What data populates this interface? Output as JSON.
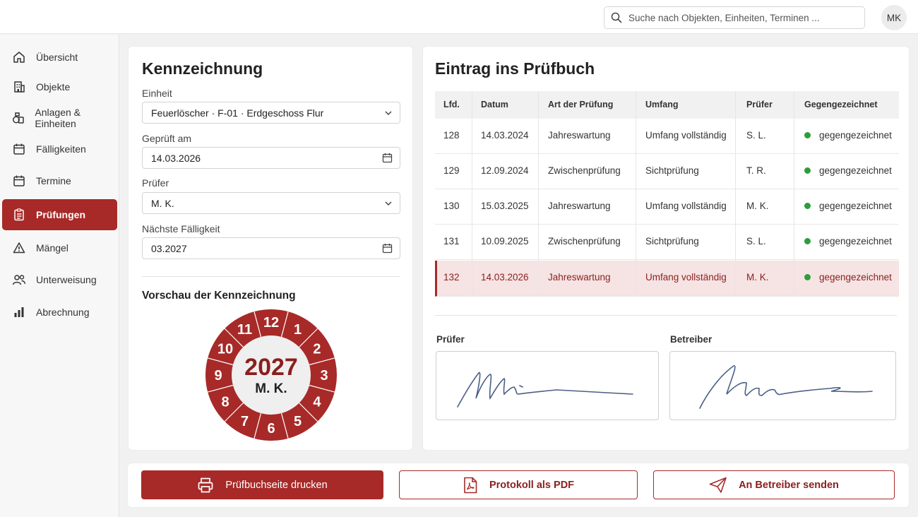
{
  "search": {
    "placeholder": "Suche nach Objekten, Einheiten, Terminen ..."
  },
  "user": {
    "initials": "MK"
  },
  "sidebar": {
    "items": [
      {
        "label": "Übersicht",
        "icon": "home-icon"
      },
      {
        "label": "Objekte",
        "icon": "building-icon"
      },
      {
        "label": "Anlagen & Einheiten",
        "icon": "units-icon"
      },
      {
        "label": "Fälligkeiten",
        "icon": "calendar-icon"
      },
      {
        "label": "Termine",
        "icon": "calendar-icon"
      },
      {
        "label": "Prüfungen",
        "icon": "checklist-icon",
        "active": true
      },
      {
        "label": "Mängel",
        "icon": "warning-icon"
      },
      {
        "label": "Unterweisung",
        "icon": "people-icon"
      },
      {
        "label": "Abrechnung",
        "icon": "bar-chart-icon"
      }
    ]
  },
  "kennzeichnung": {
    "title": "Kennzeichnung",
    "einheit": {
      "label": "Einheit",
      "value": "Feuerlöscher · F-01 · Erdgeschoss Flur"
    },
    "geprueft": {
      "label": "Geprüft am",
      "value": "14.03.2026"
    },
    "pruefer": {
      "label": "Prüfer",
      "value": "M. K."
    },
    "faelligkeit": {
      "label": "Nächste Fälligkeit",
      "value": "03.2027"
    },
    "preview_title": "Vorschau der Kennzeichnung",
    "badge": {
      "year": "2027",
      "initials": "M. K.",
      "months": [
        "12",
        "1",
        "2",
        "3",
        "4",
        "5",
        "6",
        "7",
        "8",
        "9",
        "10",
        "11"
      ]
    }
  },
  "pruefbuch": {
    "title": "Eintrag ins Prüfbuch",
    "columns": [
      "Lfd.",
      "Datum",
      "Art der Prüfung",
      "Umfang",
      "Prüfer",
      "Gegengezeichnet"
    ],
    "rows": [
      {
        "nr": "128",
        "datum": "14.03.2024",
        "art": "Jahreswartung",
        "umfang": "Umfang vollständig",
        "pruefer": "S. L.",
        "status": "gegengezeichnet"
      },
      {
        "nr": "129",
        "datum": "12.09.2024",
        "art": "Zwischenprüfung",
        "umfang": "Sichtprüfung",
        "pruefer": "T. R.",
        "status": "gegengezeichnet"
      },
      {
        "nr": "130",
        "datum": "15.03.2025",
        "art": "Jahreswartung",
        "umfang": "Umfang vollständig",
        "pruefer": "M. K.",
        "status": "gegengezeichnet"
      },
      {
        "nr": "131",
        "datum": "10.09.2025",
        "art": "Zwischenprüfung",
        "umfang": "Sichtprüfung",
        "pruefer": "S. L.",
        "status": "gegengezeichnet"
      },
      {
        "nr": "132",
        "datum": "14.03.2026",
        "art": "Jahreswartung",
        "umfang": "Umfang vollständig",
        "pruefer": "M. K.",
        "status": "gegengezeichnet",
        "highlighted": true
      }
    ],
    "signature_pruefer_label": "Prüfer",
    "signature_betreiber_label": "Betreiber"
  },
  "actions": {
    "print": "Prüfbuchseite drucken",
    "pdf": "Protokoll als PDF",
    "send": "An Betreiber senden"
  },
  "colors": {
    "accent": "#a72a28",
    "status_ok": "#2e9d3a",
    "row_highlight": "#f6e3e3"
  }
}
